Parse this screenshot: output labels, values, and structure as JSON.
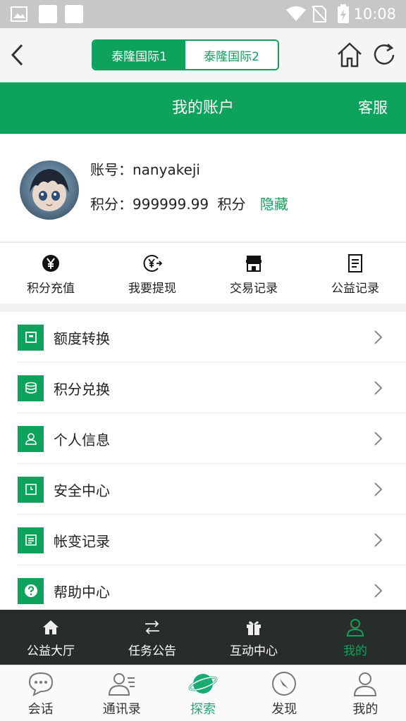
{
  "status_bar": {
    "time": "10:08"
  },
  "top_nav": {
    "tabs": [
      {
        "label": "泰隆国际1",
        "active": true
      },
      {
        "label": "泰隆国际2",
        "active": false
      }
    ]
  },
  "header": {
    "title": "我的账户",
    "service_label": "客服"
  },
  "profile": {
    "account_prefix": "账号：",
    "account": "nanyakeji",
    "points_prefix": "积分：",
    "points": "999999.99",
    "points_unit": "积分",
    "hide_label": "隐藏"
  },
  "quick_actions": [
    {
      "label": "积分充值",
      "icon": "yen-coin-icon"
    },
    {
      "label": "我要提现",
      "icon": "withdraw-icon"
    },
    {
      "label": "交易记录",
      "icon": "store-icon"
    },
    {
      "label": "公益记录",
      "icon": "document-icon"
    }
  ],
  "menu": [
    {
      "label": "额度转换",
      "icon": "box-icon"
    },
    {
      "label": "积分兑换",
      "icon": "coins-stack-icon"
    },
    {
      "label": "个人信息",
      "icon": "person-icon"
    },
    {
      "label": "安全中心",
      "icon": "clock-icon"
    },
    {
      "label": "帐变记录",
      "icon": "list-icon"
    },
    {
      "label": "帮助中心",
      "icon": "question-icon"
    }
  ],
  "inner_tabs": [
    {
      "label": "公益大厅",
      "icon": "home-icon",
      "active": false
    },
    {
      "label": "任务公告",
      "icon": "transfer-arrows-icon",
      "active": false
    },
    {
      "label": "互动中心",
      "icon": "gift-icon",
      "active": false
    },
    {
      "label": "我的",
      "icon": "user-icon",
      "active": true
    }
  ],
  "app_tabs": [
    {
      "label": "会话",
      "icon": "chat-bubble-icon",
      "active": false
    },
    {
      "label": "通讯录",
      "icon": "contacts-icon",
      "active": false
    },
    {
      "label": "探索",
      "icon": "planet-icon",
      "active": true
    },
    {
      "label": "发现",
      "icon": "compass-icon",
      "active": false
    },
    {
      "label": "我的",
      "icon": "profile-icon",
      "active": false
    }
  ],
  "colors": {
    "accent": "#0ea35c",
    "dark_bar": "#262d2a",
    "status_bar": "#c7c7c7"
  }
}
